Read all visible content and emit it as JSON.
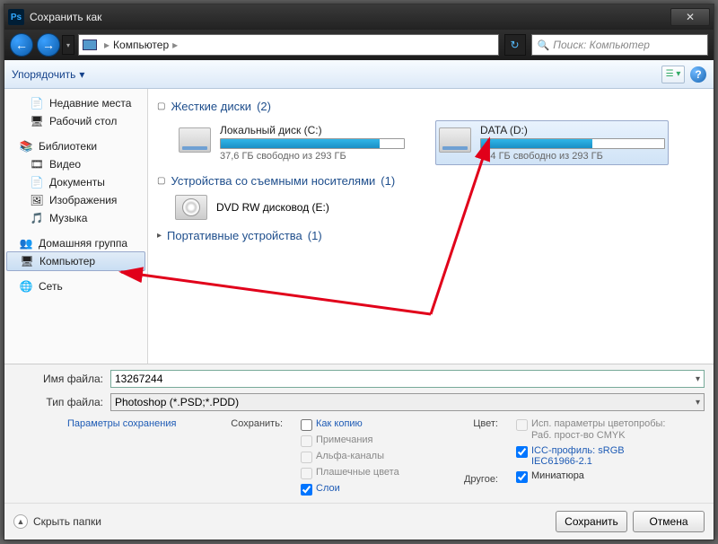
{
  "window": {
    "title": "Сохранить как"
  },
  "nav": {
    "breadcrumb_root_icon": "monitor",
    "breadcrumb_item": "Компьютер",
    "search_placeholder": "Поиск: Компьютер"
  },
  "toolbar": {
    "organize": "Упорядочить",
    "organize_arrow": "▾"
  },
  "sidebar": {
    "recent": "Недавние места",
    "desktop": "Рабочий стол",
    "libraries": "Библиотеки",
    "video": "Видео",
    "documents": "Документы",
    "images": "Изображения",
    "music": "Музыка",
    "homegroup": "Домашняя группа",
    "computer": "Компьютер",
    "network": "Сеть"
  },
  "content": {
    "hdd_header": "Жесткие диски",
    "hdd_count": "(2)",
    "drive_c": {
      "name": "Локальный диск (C:)",
      "free": "37,6 ГБ свободно из 293 ГБ",
      "fill_pct": 87
    },
    "drive_d": {
      "name": "DATA (D:)",
      "free": "114 ГБ свободно из 293 ГБ",
      "fill_pct": 61
    },
    "removable_header": "Устройства со съемными носителями",
    "removable_count": "(1)",
    "dvd_name": "DVD RW дисковод (E:)",
    "portable_header": "Портативные устройства",
    "portable_count": "(1)"
  },
  "form": {
    "filename_label": "Имя файла:",
    "filename_value": "13267244",
    "filetype_label": "Тип файла:",
    "filetype_value": "Photoshop (*.PSD;*.PDD)"
  },
  "opts": {
    "save_params_link": "Параметры сохранения",
    "save_as_label": "Сохранить:",
    "as_copy": "Как копию",
    "notes": "Примечания",
    "alpha": "Альфа-каналы",
    "spot": "Плашечные цвета",
    "layers": "Слои",
    "color_label": "Цвет:",
    "use_proof": "Исп. параметры цветопробы: Раб. прост-во CMYK",
    "icc": "ICC-профиль: sRGB IEC61966-2.1",
    "other_label": "Другое:",
    "thumbnail": "Миниатюра"
  },
  "buttons": {
    "hide_folders": "Скрыть папки",
    "save": "Сохранить",
    "cancel": "Отмена"
  }
}
